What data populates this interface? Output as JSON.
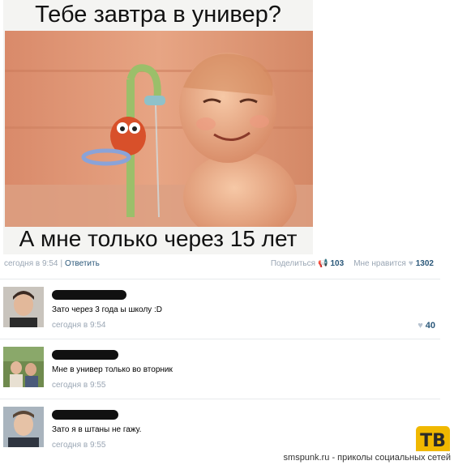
{
  "meme": {
    "top_caption": "Тебе завтра в универ?",
    "bottom_caption": "А мне только через 15 лет"
  },
  "post": {
    "time": "сегодня в 9:54",
    "reply_label": "Ответить",
    "share_label": "Поделиться",
    "share_count": "103",
    "like_label": "Мне нравится",
    "like_count": "1302"
  },
  "comments": [
    {
      "text": "Зато через 3 года ы школу :D",
      "time": "сегодня в 9:54",
      "likes": "40"
    },
    {
      "text": "Мне в универ только во вторник",
      "time": "сегодня в 9:55",
      "likes": ""
    },
    {
      "text": "Зато я в штаны не гажу.",
      "time": "сегодня в 9:55",
      "likes": ""
    }
  ],
  "watermark": {
    "site": "smspunk.ru - приколы социальных сетей",
    "logo": "ТВ",
    "logo_color": "#f0b800"
  },
  "colors": {
    "link": "#2b587a",
    "muted": "#9aa6b4"
  }
}
